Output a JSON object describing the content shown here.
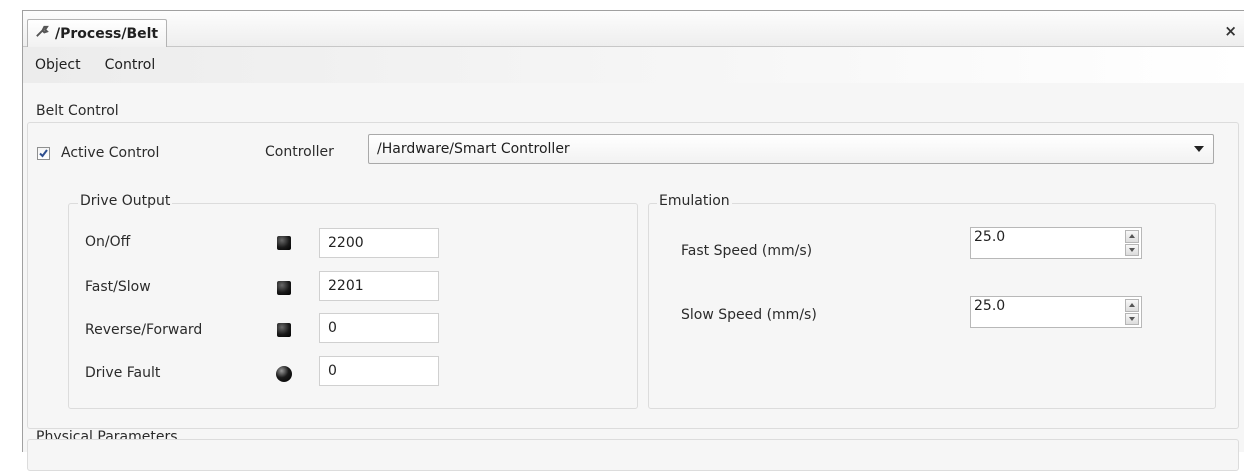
{
  "tab": {
    "title": "/Process/Belt",
    "icon": "wrench-icon"
  },
  "window": {
    "close_label": "×"
  },
  "menu": {
    "items": [
      "Object",
      "Control"
    ]
  },
  "belt_control": {
    "label": "Belt Control",
    "active_control": {
      "label": "Active Control",
      "checked": true
    },
    "controller": {
      "label": "Controller",
      "value": "/Hardware/Smart Controller"
    }
  },
  "drive_output": {
    "label": "Drive Output",
    "rows": [
      {
        "label": "On/Off",
        "indicator": "square",
        "value": "2200"
      },
      {
        "label": "Fast/Slow",
        "indicator": "square",
        "value": "2201"
      },
      {
        "label": "Reverse/Forward",
        "indicator": "square",
        "value": "0"
      },
      {
        "label": "Drive Fault",
        "indicator": "round",
        "value": "0"
      }
    ]
  },
  "emulation": {
    "label": "Emulation",
    "fast_speed": {
      "label": "Fast Speed (mm/s)",
      "value": "25.0"
    },
    "slow_speed": {
      "label": "Slow Speed (mm/s)",
      "value": "25.0"
    }
  },
  "physical_parameters": {
    "label": "Physical Parameters"
  }
}
